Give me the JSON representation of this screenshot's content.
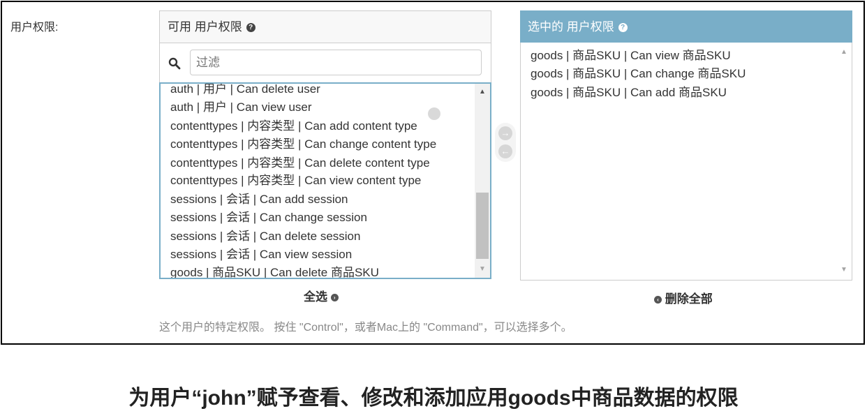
{
  "field": {
    "label": "用户权限:"
  },
  "available": {
    "title": "可用 用户权限",
    "help_icon": "?",
    "filter_placeholder": "过滤",
    "items": [
      "auth | 用户 | Can delete user",
      "auth | 用户 | Can view user",
      "contenttypes | 内容类型 | Can add content type",
      "contenttypes | 内容类型 | Can change content type",
      "contenttypes | 内容类型 | Can delete content type",
      "contenttypes | 内容类型 | Can view content type",
      "sessions | 会话 | Can add session",
      "sessions | 会话 | Can change session",
      "sessions | 会话 | Can delete session",
      "sessions | 会话 | Can view session",
      "goods | 商品SKU | Can delete 商品SKU"
    ]
  },
  "chosen": {
    "title": "选中的 用户权限",
    "help_icon": "?",
    "items": [
      "goods | 商品SKU | Can view 商品SKU",
      "goods | 商品SKU | Can change 商品SKU",
      "goods | 商品SKU | Can add 商品SKU"
    ]
  },
  "actions": {
    "choose_all": "全选",
    "remove_all": "删除全部",
    "add_arrow": "→",
    "remove_arrow": "←"
  },
  "help_text": "这个用户的特定权限。 按住 \"Control\"，或者Mac上的 \"Command\"，可以选择多个。",
  "caption": "为用户“john”赋予查看、修改和添加应用goods中商品数据的权限",
  "colors": {
    "accent": "#79aec8",
    "focus_border": "#79aec8"
  }
}
